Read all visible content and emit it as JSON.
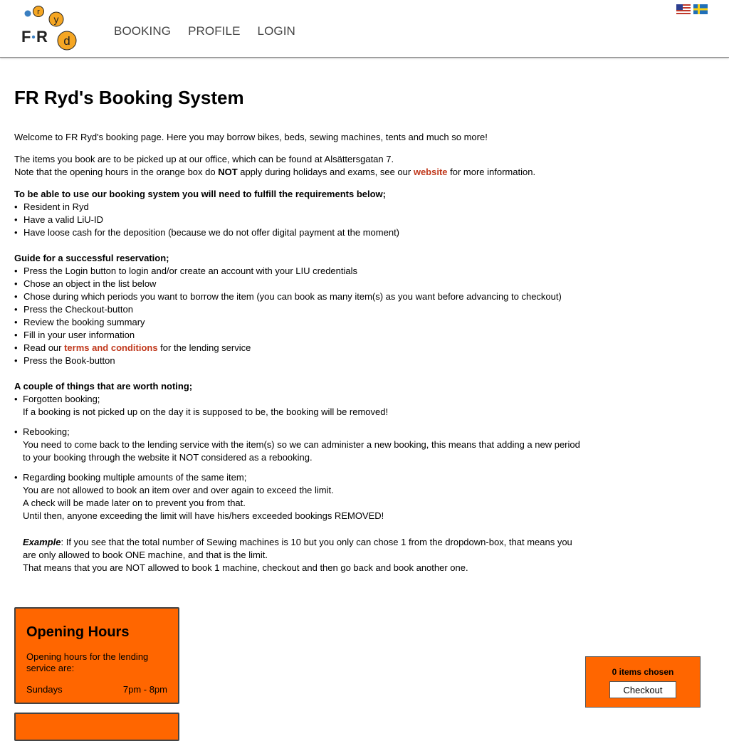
{
  "nav": {
    "logo_alt": "FRyd",
    "items": [
      "BOOKING",
      "PROFILE",
      "LOGIN"
    ]
  },
  "flags": [
    "us-flag-icon",
    "sweden-flag-icon"
  ],
  "page": {
    "title": "FR Ryd's Booking System",
    "welcome": "Welcome to FR Ryd's booking page. Here you may borrow bikes, beds, sewing machines, tents and much so more!",
    "pickup": "The items you book are to be picked up at our office, which can be found at Alsättersgatan 7.",
    "note_prefix": "Note that the opening hours in the orange box do ",
    "note_not": "NOT",
    "note_mid": " apply during holidays and exams, see our ",
    "note_link": "website",
    "note_suffix": " for more information.",
    "requirements_title": "To be able to use our booking system you will need to fulfill the requirements below;",
    "requirements": [
      "Resident in Ryd",
      "Have a valid LiU-ID",
      "Have loose cash for the deposition (because we do not offer digital payment at the moment)"
    ],
    "guide_title": "Guide for a successful reservation;",
    "guide": [
      "Press the Login button to login and/or create an account with your LIU credentials",
      "Chose an object in the list below",
      "Chose during which periods you want to borrow the item (you can book as many item(s) as you want before advancing to checkout)",
      "Press the Checkout-button",
      "Review the booking summary",
      "Fill in your user information"
    ],
    "guide_terms_prefix": "Read our ",
    "guide_terms_link": "terms and conditions",
    "guide_terms_suffix": " for the lending service",
    "guide_last": "Press the Book-button",
    "notes_title": "A couple of things that are worth noting;",
    "notes": {
      "forgotten_title": "Forgotten booking;",
      "forgotten_text": "If a booking is not picked up on the day it is supposed to be, the booking will be removed!",
      "rebooking_title": "Rebooking;",
      "rebooking_text1": "You need to come back to the lending service with the item(s) so we can administer a new booking, this means that adding a new period",
      "rebooking_text2": "to your booking through the website it NOT considered as a rebooking.",
      "multiple_title": "Regarding booking multiple amounts of the same item;",
      "multiple_text1": "You are not allowed to book an item over and over again to exceed the limit.",
      "multiple_text2": "A check will be made later on to prevent you from that.",
      "multiple_text3": "Until then, anyone exceeding the limit will have his/hers exceeded bookings REMOVED!",
      "example_label": "Example",
      "example_text1": ": If you see that the total number of Sewing machines is 10 but you only can chose 1 from the dropdown-box, that means you",
      "example_text2": "are only allowed to book ONE machine, and that is the limit.",
      "example_text3": "That means that you are NOT allowed to book 1 machine, checkout and then go back and book another one."
    }
  },
  "hours": {
    "title": "Opening Hours",
    "desc": "Opening hours for the lending service are:",
    "day": "Sundays",
    "time": "7pm - 8pm"
  },
  "cart": {
    "count_label": "0 items chosen",
    "checkout_label": "Checkout"
  },
  "colors": {
    "accent": "#ff6600",
    "link": "#c0391d"
  }
}
